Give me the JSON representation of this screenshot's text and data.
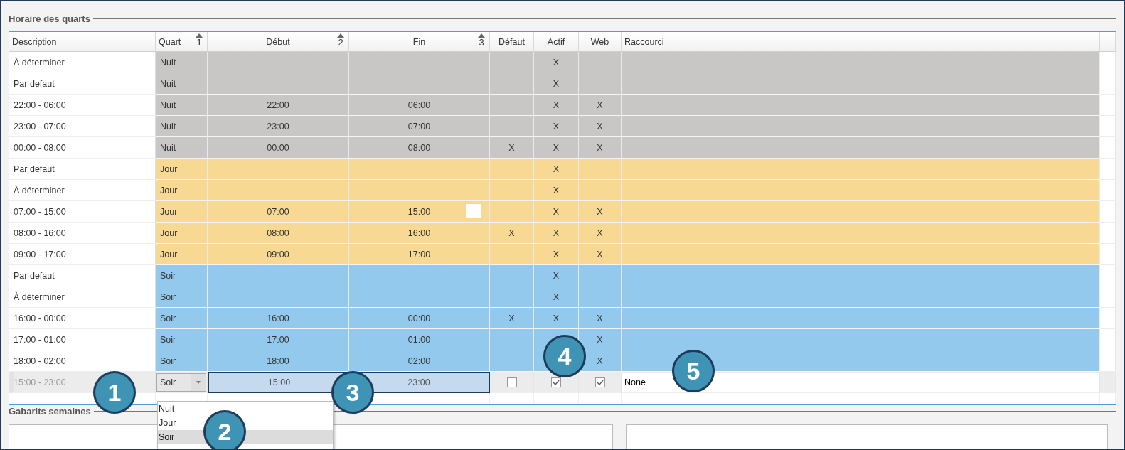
{
  "section_title": "Horaire des quarts",
  "columns": [
    {
      "label": "Description"
    },
    {
      "label": "Quart",
      "sort": "1"
    },
    {
      "label": "Début",
      "sort": "2"
    },
    {
      "label": "Fin",
      "sort": "3"
    },
    {
      "label": "Défaut"
    },
    {
      "label": "Actif"
    },
    {
      "label": "Web"
    },
    {
      "label": "Raccourci"
    }
  ],
  "rows": [
    {
      "description": "À déterminer",
      "shift": "Nuit",
      "color": "#c8c7c5",
      "active": "X"
    },
    {
      "description": "Par defaut",
      "shift": "Nuit",
      "color": "#c8c7c5",
      "active": "X"
    },
    {
      "description": "22:00 - 06:00",
      "shift": "Nuit",
      "color": "#c8c7c5",
      "start": "22:00",
      "end": "06:00",
      "active": "X",
      "web": "X"
    },
    {
      "description": "23:00 - 07:00",
      "shift": "Nuit",
      "color": "#c8c7c5",
      "start": "23:00",
      "end": "07:00",
      "active": "X",
      "web": "X"
    },
    {
      "description": "00:00 - 08:00",
      "shift": "Nuit",
      "color": "#c8c7c5",
      "start": "00:00",
      "end": "08:00",
      "default": "X",
      "active": "X",
      "web": "X"
    },
    {
      "description": "Par defaut",
      "shift": "Jour",
      "color": "#f8d994",
      "active": "X"
    },
    {
      "description": "À déterminer",
      "shift": "Jour",
      "color": "#f8d994",
      "active": "X"
    },
    {
      "description": "07:00 - 15:00",
      "shift": "Jour",
      "color": "#f8d994",
      "start": "07:00",
      "end": "15:00",
      "active": "X",
      "web": "X",
      "marker": true
    },
    {
      "description": "08:00 - 16:00",
      "shift": "Jour",
      "color": "#f8d994",
      "start": "08:00",
      "end": "16:00",
      "default": "X",
      "active": "X",
      "web": "X"
    },
    {
      "description": "09:00 - 17:00",
      "shift": "Jour",
      "color": "#f8d994",
      "start": "09:00",
      "end": "17:00",
      "active": "X",
      "web": "X"
    },
    {
      "description": "Par defaut",
      "shift": "Soir",
      "color": "#92c9ed",
      "active": "X"
    },
    {
      "description": "À déterminer",
      "shift": "Soir",
      "color": "#92c9ed",
      "active": "X"
    },
    {
      "description": "16:00 - 00:00",
      "shift": "Soir",
      "color": "#92c9ed",
      "start": "16:00",
      "end": "00:00",
      "default": "X",
      "active": "X",
      "web": "X"
    },
    {
      "description": "17:00 - 01:00",
      "shift": "Soir",
      "color": "#92c9ed",
      "start": "17:00",
      "end": "01:00",
      "web": "X"
    },
    {
      "description": "18:00 - 02:00",
      "shift": "Soir",
      "color": "#92c9ed",
      "start": "18:00",
      "end": "02:00",
      "web": "X"
    }
  ],
  "edit_row": {
    "description": "15:00 - 23:00",
    "shift": "Soir",
    "start": "15:00",
    "end": "23:00",
    "default": false,
    "active": true,
    "web": true,
    "shortcut": "None"
  },
  "dropdown": {
    "options": [
      {
        "label": "Nuit",
        "selected": false
      },
      {
        "label": "Jour",
        "selected": false
      },
      {
        "label": "Soir",
        "selected": true
      }
    ]
  },
  "callouts": [
    "1",
    "2",
    "3",
    "4",
    "5"
  ],
  "second_section": {
    "title": "Gabarits semaines"
  }
}
